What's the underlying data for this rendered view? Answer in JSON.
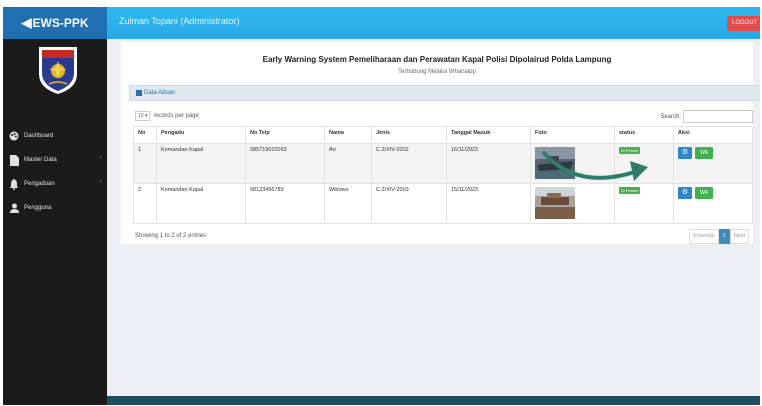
{
  "brand": {
    "name": "EWS-PPK",
    "arrow_glyph": "◀"
  },
  "topbar": {
    "user": "Zulman Topani (Administrator)",
    "logout": "LOGOUT"
  },
  "sidebar": {
    "items": [
      {
        "label": "Dashboard",
        "icon": "palette-icon"
      },
      {
        "label": "Master Data",
        "icon": "file-icon",
        "chevron": "‹"
      },
      {
        "label": "Pengaduan",
        "icon": "bell-icon",
        "chevron": "‹"
      },
      {
        "label": "Pengguna",
        "icon": "user-icon"
      }
    ]
  },
  "main": {
    "title": "Early Warning System Pemeliharaan dan Perawatan Kapal Polisi Dipolairud Polda Lampung",
    "subtitle": "Terhubung Melalui Whatsapp",
    "panel_title": "Data Aduan"
  },
  "table": {
    "length_value": "10",
    "length_suffix": "records per page",
    "search_label": "Search:",
    "headers": [
      "No",
      "Pengadu",
      "No Telp",
      "Nama",
      "Jenis",
      "Tanggal Masuk",
      "Foto",
      "status",
      "Aksi"
    ],
    "rows": [
      {
        "no": "1",
        "pengadu": "Komandan Kapal",
        "telp": "085719010093",
        "nama": "Ari",
        "jenis": "C.2/XIV-2002",
        "tanggal": "16/11/2023",
        "status": "Di Proses",
        "wa": "WA"
      },
      {
        "no": "2",
        "pengadu": "Komandan Kapal",
        "telp": "08123456789",
        "nama": "Wibowo",
        "jenis": "C.2/XIV-2003",
        "tanggal": "15/11/2023",
        "status": "Di Proses",
        "wa": "WA"
      }
    ],
    "info": "Showing 1 to 2 of 2 entries",
    "pagination": {
      "previous": "Previous",
      "page": "1",
      "next": "Next"
    }
  },
  "colors": {
    "accent": "#29a8e6",
    "sidebar": "#1b1b1b",
    "arrow": "#2e7d6b",
    "success": "#3fb34f",
    "primary": "#2f85c7",
    "danger": "#e24b4b"
  }
}
